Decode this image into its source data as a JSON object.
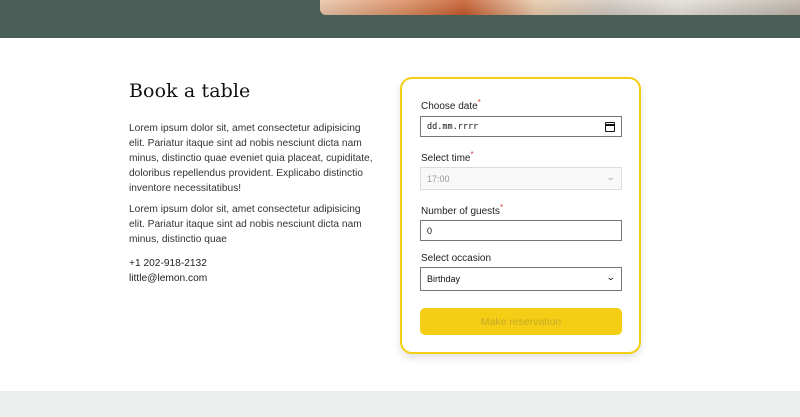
{
  "section": {
    "title": "Book a table",
    "paragraph1": "Lorem ipsum dolor sit, amet consectetur adipisicing elit. Pariatur itaque sint ad nobis nesciunt dicta nam minus, distinctio quae eveniet quia placeat, cupiditate, doloribus repellendus provident. Explicabo distinctio inventore necessitatibus!",
    "paragraph2": "Lorem ipsum dolor sit, amet consectetur adipisicing elit. Pariatur itaque sint ad nobis nesciunt dicta nam minus, distinctio quae",
    "phone": "+1 202-918-2132",
    "email": "little@lemon.com"
  },
  "form": {
    "date_label": "Choose date",
    "date_value": "dd.mm.rrrr",
    "time_label": "Select time",
    "time_value": "17:00",
    "guests_label": "Number of guests",
    "guests_value": "0",
    "occasion_label": "Select occasion",
    "occasion_value": "Birthday",
    "required_mark": "*",
    "submit_label": "Make reservation"
  },
  "colors": {
    "brand_green": "#495e57",
    "brand_yellow": "#f4ce14",
    "required_red": "#e53935"
  }
}
